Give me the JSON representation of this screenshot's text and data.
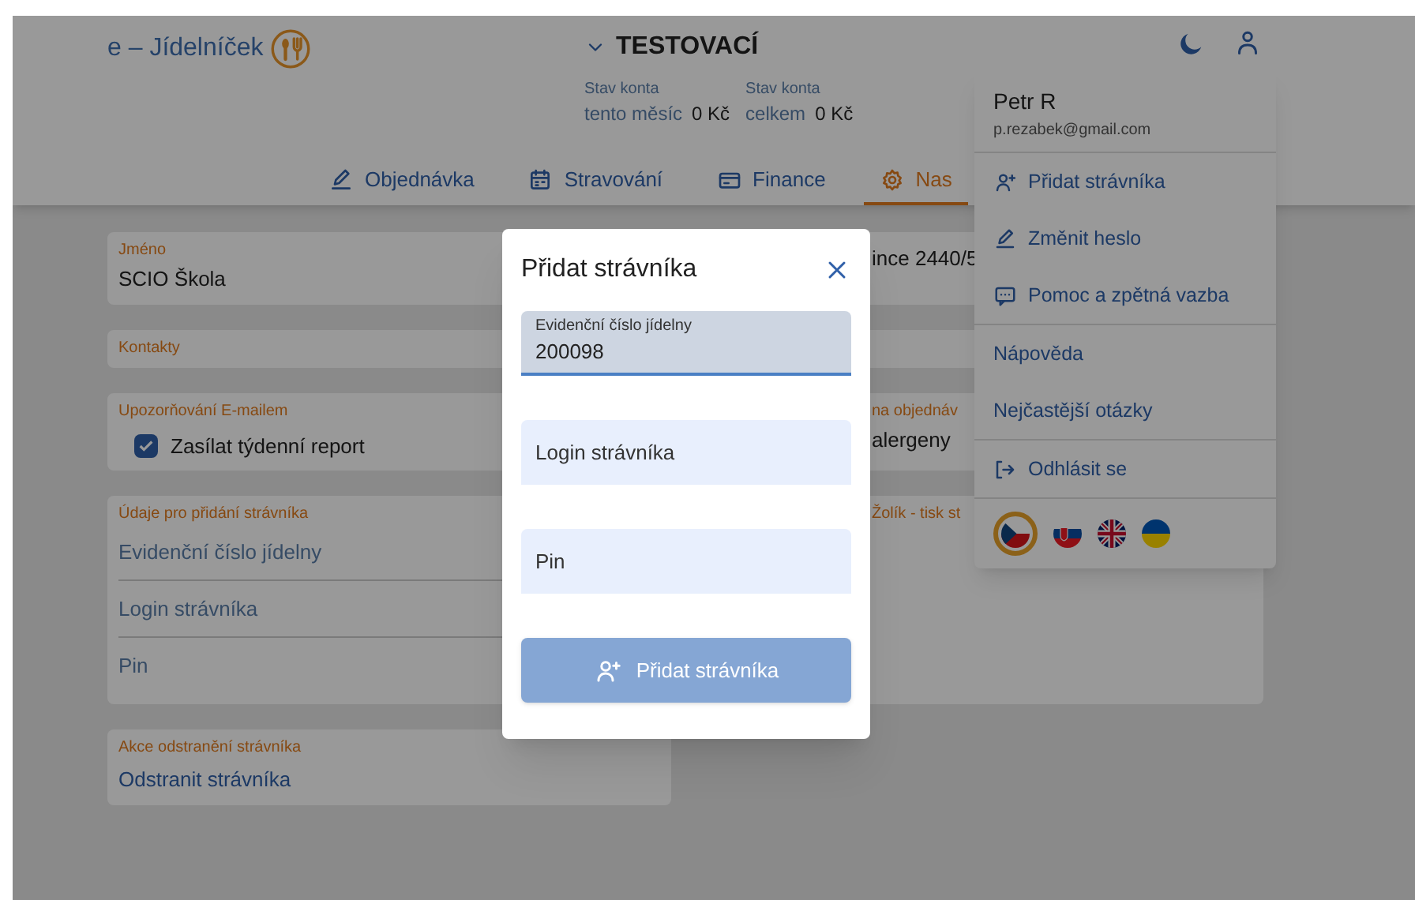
{
  "header": {
    "logo": "e – Jídelníček",
    "account_name": "TESTOVACÍ",
    "balances": [
      {
        "label": "Stav konta",
        "period": "tento měsíc",
        "amount": "0 Kč"
      },
      {
        "label": "Stav konta",
        "period": "celkem",
        "amount": "0 Kč"
      }
    ]
  },
  "tabs": [
    {
      "label": "Objednávka",
      "kind": "pencil",
      "selected": false
    },
    {
      "label": "Stravování",
      "kind": "calendar",
      "selected": false
    },
    {
      "label": "Finance",
      "kind": "card",
      "selected": false
    },
    {
      "label": "Nas",
      "kind": "gear",
      "selected": true
    }
  ],
  "left_cards": [
    {
      "kind": "field",
      "label": "Jméno",
      "value": "SCIO Škola"
    },
    {
      "kind": "label",
      "label": "Kontakty"
    },
    {
      "kind": "checkbox",
      "label": "Upozorňování E-mailem",
      "option": "Zasílat týdenní report",
      "checked": true
    },
    {
      "kind": "list",
      "label": "Údaje pro přidání strávníka",
      "items": [
        "Evidenční číslo jídelny",
        "Login strávníka",
        "Pin"
      ]
    },
    {
      "kind": "link",
      "label": "Akce odstranění strávníka",
      "value": "Odstranit strávníka"
    }
  ],
  "right_cards": [
    {
      "kind": "field",
      "value": "ince 2440/5"
    },
    {
      "kind": "label"
    },
    {
      "kind": "field",
      "label": "na objednáv",
      "value": "alergeny"
    },
    {
      "kind": "field",
      "label": "Žolík - tisk st"
    }
  ],
  "user_menu": {
    "name": "Petr R",
    "email": "p.rezabek@gmail.com",
    "sections": [
      {
        "items": [
          {
            "label": "Přidat strávníka",
            "kind": "add-person"
          },
          {
            "label": "Změnit heslo",
            "kind": "pencil"
          },
          {
            "label": "Pomoc a zpětná vazba",
            "kind": "chat"
          }
        ]
      },
      {
        "items": [
          {
            "label": "Nápověda",
            "kind": "plain"
          },
          {
            "label": "Nejčastější otázky",
            "kind": "plain"
          }
        ]
      },
      {
        "items": [
          {
            "label": "Odhlásit se",
            "kind": "logout"
          }
        ]
      }
    ],
    "languages": [
      {
        "kind": "cz",
        "selected": true
      },
      {
        "kind": "sk",
        "selected": false
      },
      {
        "kind": "gb",
        "selected": false
      },
      {
        "kind": "ua",
        "selected": false
      }
    ]
  },
  "dialog": {
    "title": "Přidat strávníka",
    "fields": [
      {
        "label": "Evidenční číslo jídelny",
        "value": "200098",
        "focused": true
      },
      {
        "placeholder": "Login strávníka",
        "focused": false
      },
      {
        "placeholder": "Pin",
        "focused": false
      }
    ],
    "button": {
      "label": "Přidat strávníka",
      "disabled": true
    }
  }
}
